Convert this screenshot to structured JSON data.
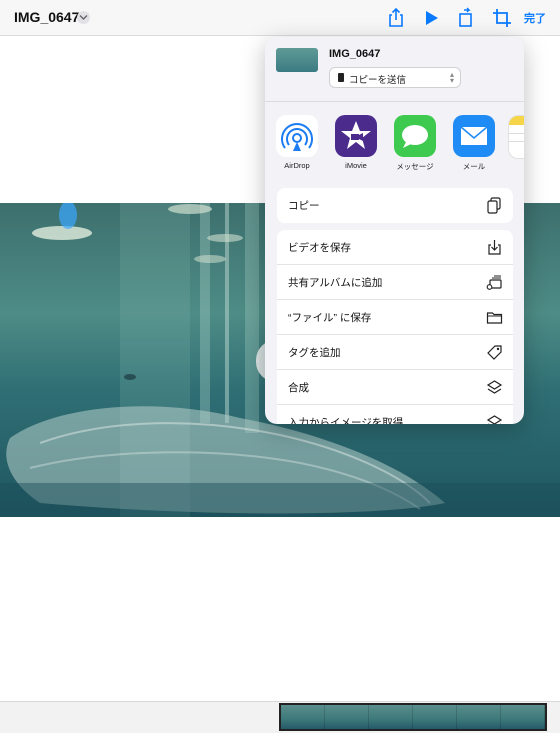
{
  "header": {
    "title": "IMG_0647",
    "done_label": "完了",
    "icons": [
      "share-icon",
      "play-icon",
      "rotate-icon",
      "crop-icon"
    ],
    "accent": "#0a7aff"
  },
  "share_sheet": {
    "file_name": "IMG_0647",
    "send_option": "コピーを送信",
    "apps": [
      {
        "name": "AirDrop",
        "icon": "airdrop-icon",
        "color": "#ffffff"
      },
      {
        "name": "iMovie",
        "icon": "imovie-icon",
        "color": "#4b2b8c"
      },
      {
        "name": "メッセージ",
        "icon": "messages-icon",
        "color": "#3ec94f"
      },
      {
        "name": "メール",
        "icon": "mail-icon",
        "color": "#1f8bf5"
      }
    ],
    "copy_action": {
      "label": "コピー",
      "icon": "copy-icon"
    },
    "actions": [
      {
        "label": "ビデオを保存",
        "icon": "save-download-icon"
      },
      {
        "label": "共有アルバムに追加",
        "icon": "shared-album-icon"
      },
      {
        "label": "“ファイル” に保存",
        "icon": "folder-icon"
      },
      {
        "label": "タグを追加",
        "icon": "tag-icon"
      },
      {
        "label": "合成",
        "icon": "layers-icon"
      },
      {
        "label": "入力からイメージを取得",
        "icon": "layers-icon"
      }
    ]
  }
}
